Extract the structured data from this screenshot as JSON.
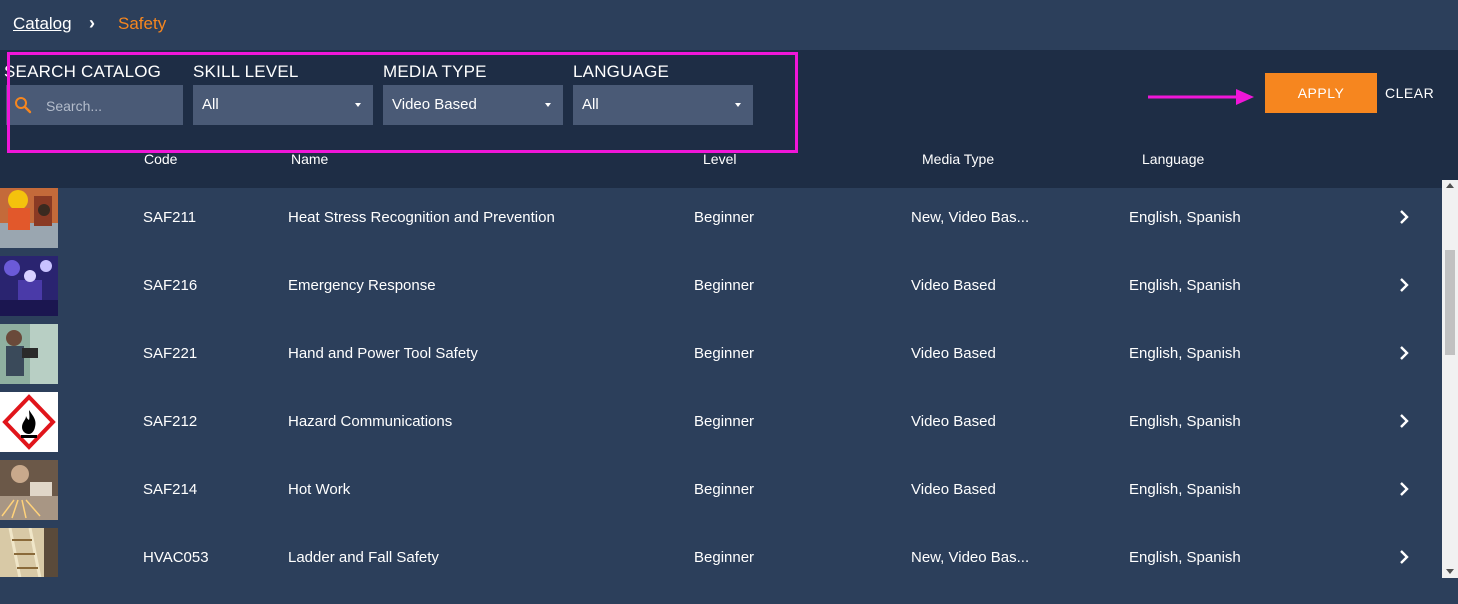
{
  "breadcrumb": {
    "root": "Catalog",
    "current": "Safety"
  },
  "filters": {
    "search": {
      "label": "SEARCH CATALOG",
      "placeholder": "Search...",
      "value": ""
    },
    "skill_level": {
      "label": "SKILL LEVEL",
      "value": "All"
    },
    "media_type": {
      "label": "MEDIA TYPE",
      "value": "Video Based"
    },
    "language": {
      "label": "LANGUAGE",
      "value": "All"
    }
  },
  "actions": {
    "apply_label": "APPLY",
    "clear_label": "CLEAR"
  },
  "table": {
    "columns": [
      "Code",
      "Name",
      "Level",
      "Media Type",
      "Language"
    ],
    "rows": [
      {
        "code": "SAF211",
        "name": "Heat Stress Recognition and Prevention",
        "level": "Beginner",
        "media": "New, Video Bas...",
        "language": "English, Spanish",
        "thumb_icon": "worker-photo-icon"
      },
      {
        "code": "SAF216",
        "name": "Emergency Response",
        "level": "Beginner",
        "media": "Video Based",
        "language": "English, Spanish",
        "thumb_icon": "emergency-photo-icon"
      },
      {
        "code": "SAF221",
        "name": "Hand and Power Tool Safety",
        "level": "Beginner",
        "media": "Video Based",
        "language": "English, Spanish",
        "thumb_icon": "power-tool-photo-icon"
      },
      {
        "code": "SAF212",
        "name": "Hazard Communications",
        "level": "Beginner",
        "media": "Video Based",
        "language": "English, Spanish",
        "thumb_icon": "flammable-hazard-icon"
      },
      {
        "code": "SAF214",
        "name": "Hot Work",
        "level": "Beginner",
        "media": "Video Based",
        "language": "English, Spanish",
        "thumb_icon": "grinding-sparks-photo-icon"
      },
      {
        "code": "HVAC053",
        "name": "Ladder and Fall Safety",
        "level": "Beginner",
        "media": "New, Video Bas...",
        "language": "English, Spanish",
        "thumb_icon": "ladder-photo-icon"
      }
    ]
  },
  "colors": {
    "background": "#2c3f5b",
    "panel": "#1e2d45",
    "input": "#4a5a76",
    "accent": "#f6861f",
    "annotation": "#f016d8"
  }
}
